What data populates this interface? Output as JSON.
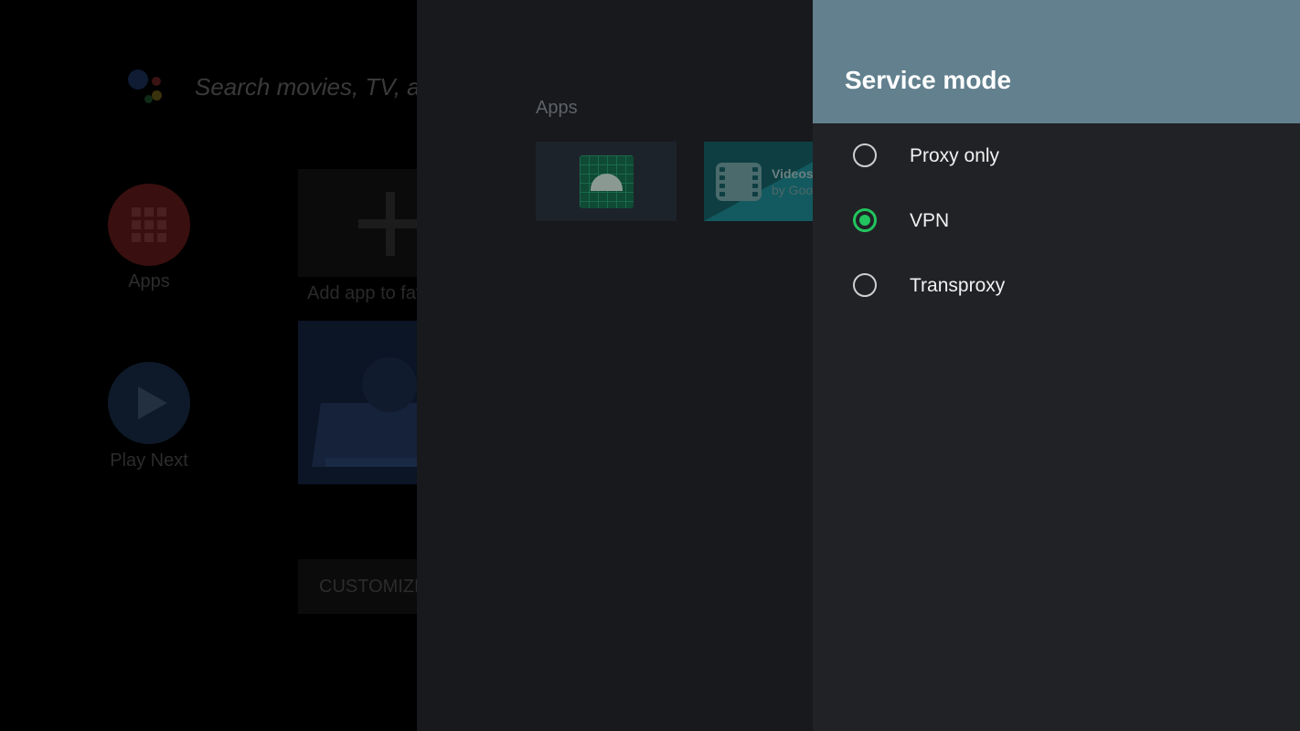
{
  "launcher": {
    "search_placeholder": "Search movies, TV, and more",
    "nav_apps_label": "Apps",
    "nav_play_next_label": "Play Next",
    "add_favorite_label": "Add app to favorites",
    "customize_label": "CUSTOMIZE CHANNELS"
  },
  "apps_panel": {
    "heading": "Apps",
    "videos_app": {
      "title": "Videos",
      "subtitle": "by Google"
    }
  },
  "dialog": {
    "title": "Service mode",
    "options": [
      {
        "label": "Proxy only",
        "checked": false
      },
      {
        "label": "VPN",
        "checked": true
      },
      {
        "label": "Transproxy",
        "checked": false
      }
    ]
  },
  "colors": {
    "dialog_header": "#62808e",
    "dialog_bg": "#212226",
    "radio_accent": "#22c55e"
  }
}
